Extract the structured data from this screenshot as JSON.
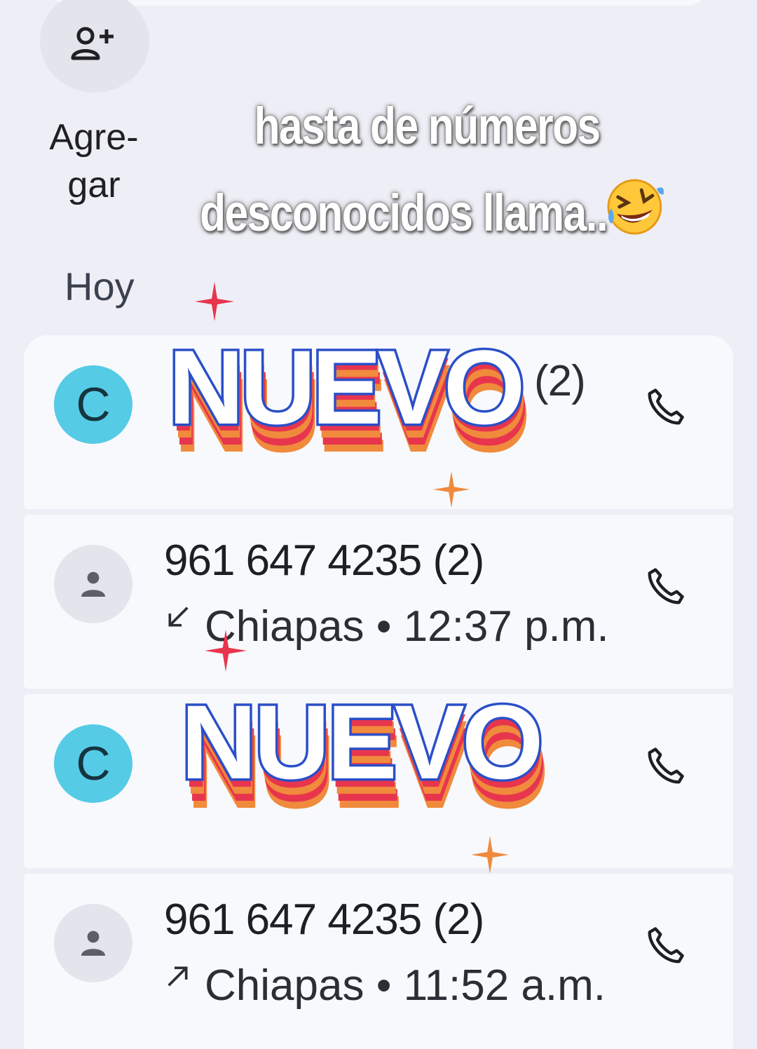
{
  "add_contact": {
    "label": "Agre-\ngar",
    "icon": "add-person-icon"
  },
  "overlay": {
    "caption_line1": "hasta de números",
    "caption_line2": "desconocidos llama..",
    "emoji": "🤣"
  },
  "section": {
    "title": "Hoy"
  },
  "sticker_text": "NUEVO",
  "calls": [
    {
      "name": "(2)",
      "avatar_letter": "C",
      "direction": "outgoing",
      "detail": "",
      "obscured": true
    },
    {
      "name": "961 647 4235 (2)",
      "avatar_letter": "",
      "direction": "missed",
      "detail": "Chiapas • 12:37 p.m.",
      "obscured": false
    },
    {
      "name": "",
      "avatar_letter": "C",
      "direction": "outgoing",
      "detail": "",
      "obscured": true
    },
    {
      "name": "961 647 4235 (2)",
      "avatar_letter": "",
      "direction": "outgoing",
      "detail": "Chiapas • 11:52 a.m.",
      "obscured": false
    }
  ],
  "colors": {
    "background": "#eeeff6",
    "card": "#f8f9fd",
    "avatar_letter_bg": "#55cbe6",
    "avatar_generic_bg": "#e4e5ec",
    "sticker_blue": "#2a4fc8",
    "sticker_red": "#e8354e",
    "sticker_orange": "#f08a3c",
    "sparkle_red": "#e8354e",
    "sparkle_orange": "#f08a3c"
  }
}
